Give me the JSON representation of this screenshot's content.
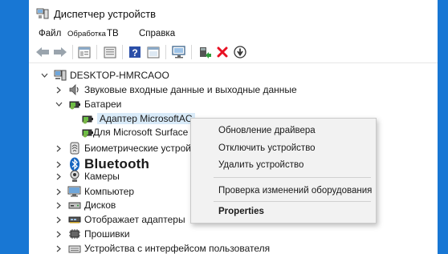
{
  "window": {
    "title": "Диспетчер устройств"
  },
  "menu": {
    "file": "Файл",
    "action": "Обработка",
    "view": "ТВ",
    "help": "Справка"
  },
  "toolbar": {
    "icons": [
      "back-arrow-icon",
      "forward-arrow-icon",
      "properties-icon",
      "show-hidden-icon",
      "help-icon",
      "panel-icon",
      "scan-hardware-icon",
      "update-driver-icon",
      "uninstall-device-icon",
      "disable-device-icon"
    ]
  },
  "tree": {
    "root": "DESKTOP-HMRCAOO",
    "items": [
      {
        "label": "Звуковые входные данные и выходные данные",
        "icon": "speaker-icon"
      },
      {
        "label": "Батареи",
        "icon": "battery-icon",
        "expanded": true,
        "children": [
          "Адаптер MicrosoftAC",
          "Для Microsoft Surface ACV"
        ]
      },
      {
        "label": "Биометрические устройства",
        "icon": "biometric-icon"
      },
      {
        "label": "Bluetooth",
        "icon": "bluetooth-icon"
      },
      {
        "label": "Камеры",
        "icon": "camera-icon"
      },
      {
        "label": "Компьютер",
        "icon": "computer-icon"
      },
      {
        "label": "Дисков",
        "icon": "disk-icon"
      },
      {
        "label": "Отображает адаптеры",
        "icon": "display-adapter-icon"
      },
      {
        "label": "Прошивки",
        "icon": "firmware-icon"
      },
      {
        "label": "Устройства с интерфейсом пользователя",
        "icon": "hid-icon"
      }
    ]
  },
  "context_menu": {
    "items": [
      "Обновление драйвера",
      "Отключить устройство",
      "Удалить устройство",
      "Проверка изменений оборудования",
      "Properties"
    ]
  },
  "colors": {
    "accent": "#1877d4",
    "selection": "#d9ebf9",
    "menu_bg": "#f2f2f2",
    "delete_red": "#e81123"
  }
}
